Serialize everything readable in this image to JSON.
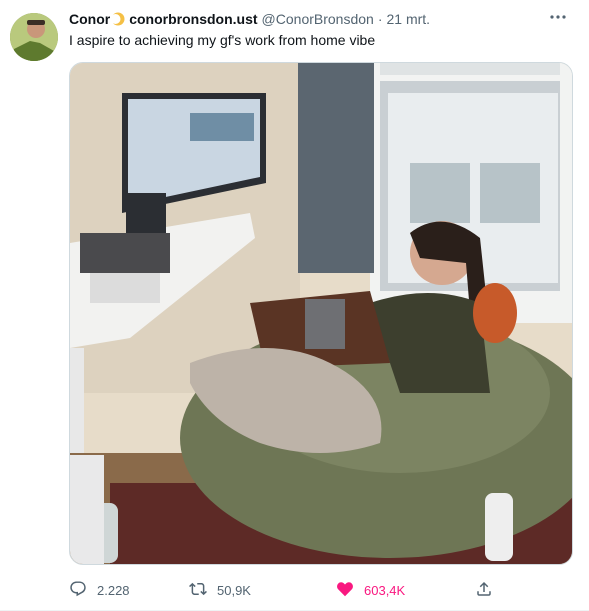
{
  "tweet": {
    "author_name": "Conor",
    "display_handle": "conorbronsdon.ust",
    "username": "@ConorBronsdon",
    "separator": "·",
    "date": "21 mrt.",
    "more_label": "•••",
    "text": "I aspire to achieving my gf's work from home vibe"
  },
  "stats": {
    "replies": "2.228",
    "retweets": "50,9K",
    "likes": "603,4K"
  },
  "colors": {
    "like": "#f91880",
    "muted": "#536471",
    "text": "#0f1419"
  },
  "icons": {
    "reply": "reply-icon",
    "retweet": "retweet-icon",
    "like": "heart-icon",
    "share": "share-icon",
    "more": "more-icon",
    "badge": "moon-emoji-icon"
  }
}
